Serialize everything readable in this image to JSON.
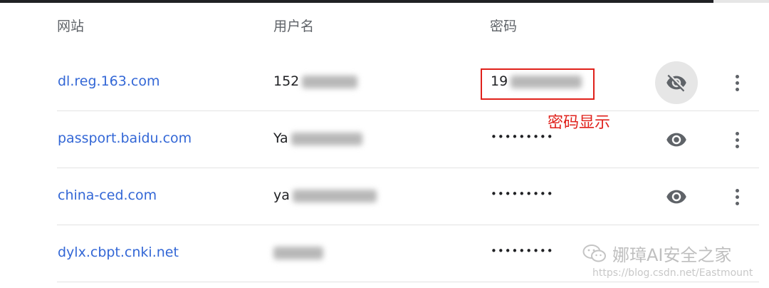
{
  "headers": {
    "site": "网站",
    "username": "用户名",
    "password": "密码"
  },
  "rows": [
    {
      "site": "dl.reg.163.com",
      "username_visible": "152",
      "password_visible": "19",
      "password_shown": true,
      "eye_icon": "eye-off-icon"
    },
    {
      "site": "passport.baidu.com",
      "username_visible": "Ya",
      "password_masked": "•••••••••",
      "password_shown": false,
      "eye_icon": "eye-icon"
    },
    {
      "site": "china-ced.com",
      "username_visible": "ya",
      "password_masked": "•••••••••",
      "password_shown": false,
      "eye_icon": "eye-icon"
    },
    {
      "site": "dylx.cbpt.cnki.net",
      "username_visible": "",
      "password_masked": "•••••••••",
      "password_shown": false,
      "eye_icon": "eye-icon"
    }
  ],
  "annotation": {
    "text": "密码显示",
    "color": "#e0211b"
  },
  "watermark": {
    "brand": "娜璋AI安全之家",
    "url": "https://blog.csdn.net/Eastmount"
  },
  "colors": {
    "link": "#3367d6",
    "header": "#5f6368",
    "text": "#202124"
  }
}
